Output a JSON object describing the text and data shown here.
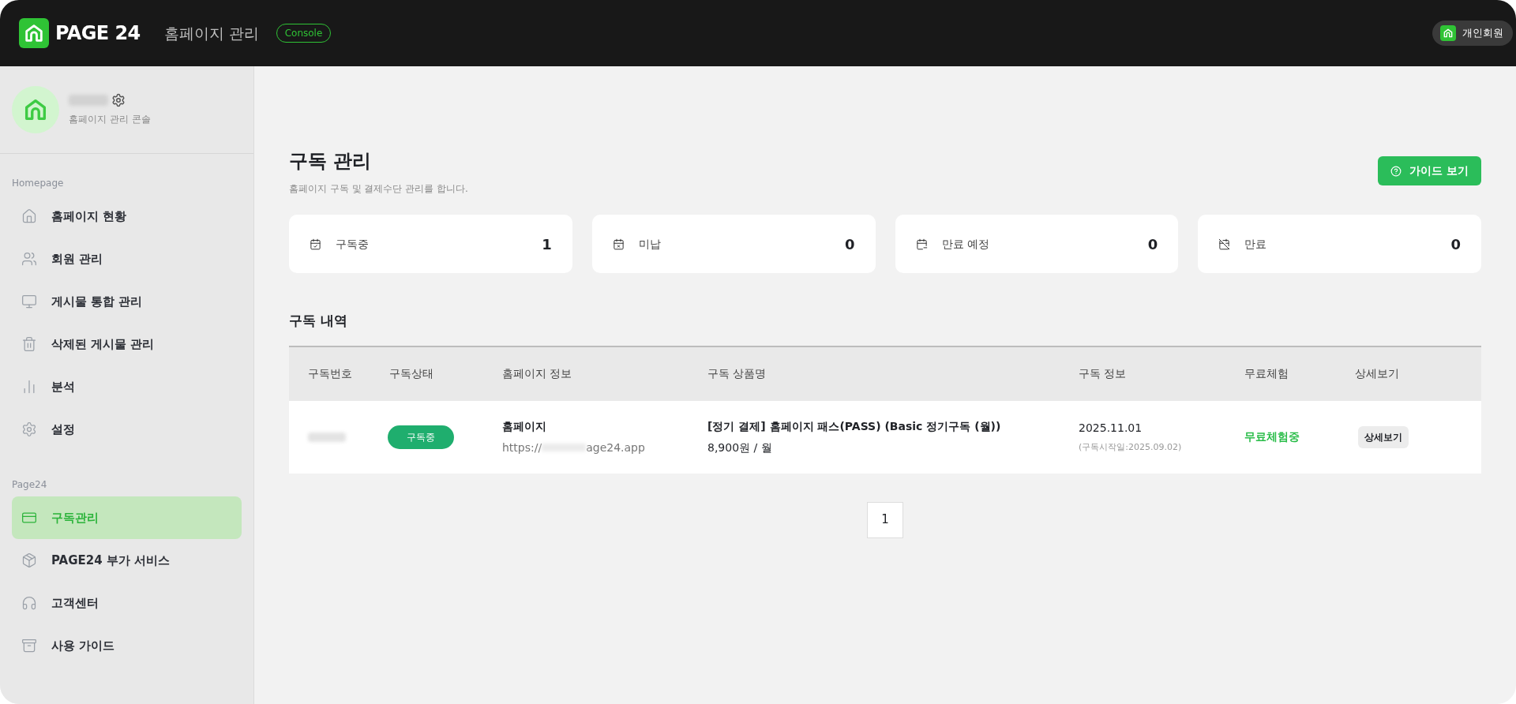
{
  "header": {
    "logo_text": "PAGE 24",
    "title": "홈페이지 관리",
    "badge": "Console",
    "account_label": "개인회원"
  },
  "profile": {
    "subtitle": "홈페이지 관리 콘솔"
  },
  "sidebar": {
    "sections": [
      {
        "title": "Homepage",
        "items": [
          {
            "label": "홈페이지 현황",
            "selected": false
          },
          {
            "label": "회원 관리",
            "selected": false
          },
          {
            "label": "게시물 통합 관리",
            "selected": false
          },
          {
            "label": "삭제된 게시물 관리",
            "selected": false
          },
          {
            "label": "분석",
            "selected": false
          },
          {
            "label": "설정",
            "selected": false
          }
        ]
      },
      {
        "title": "Page24",
        "items": [
          {
            "label": "구독관리",
            "selected": true
          },
          {
            "label": "PAGE24 부가 서비스",
            "selected": false
          },
          {
            "label": "고객센터",
            "selected": false
          },
          {
            "label": "사용 가이드",
            "selected": false
          }
        ]
      }
    ]
  },
  "page": {
    "title": "구독 관리",
    "subtitle": "홈페이지 구독 및 결제수단 관리를 합니다.",
    "guide_button": "가이드 보기"
  },
  "stats": [
    {
      "label": "구독중",
      "value": "1"
    },
    {
      "label": "미납",
      "value": "0"
    },
    {
      "label": "만료 예정",
      "value": "0"
    },
    {
      "label": "만료",
      "value": "0"
    }
  ],
  "table": {
    "title": "구독 내역",
    "columns": [
      "구독번호",
      "구독상태",
      "홈페이지 정보",
      "구독 상품명",
      "구독 정보",
      "무료체험",
      "상세보기"
    ],
    "rows": [
      {
        "status": "구독중",
        "site_name": "홈페이지",
        "url_start": "https://",
        "url_end": "age24.app",
        "product": "[정기 결제] 홈페이지 패스(PASS) (Basic 정기구독 (월))",
        "price": "8,900원 / 월",
        "date": "2025.11.01",
        "start_note": "(구독시작일:2025.09.02)",
        "trial": "무료체험중",
        "detail_button": "상세보기"
      }
    ]
  },
  "pagination": [
    {
      "label": "1",
      "selected": true
    }
  ]
}
